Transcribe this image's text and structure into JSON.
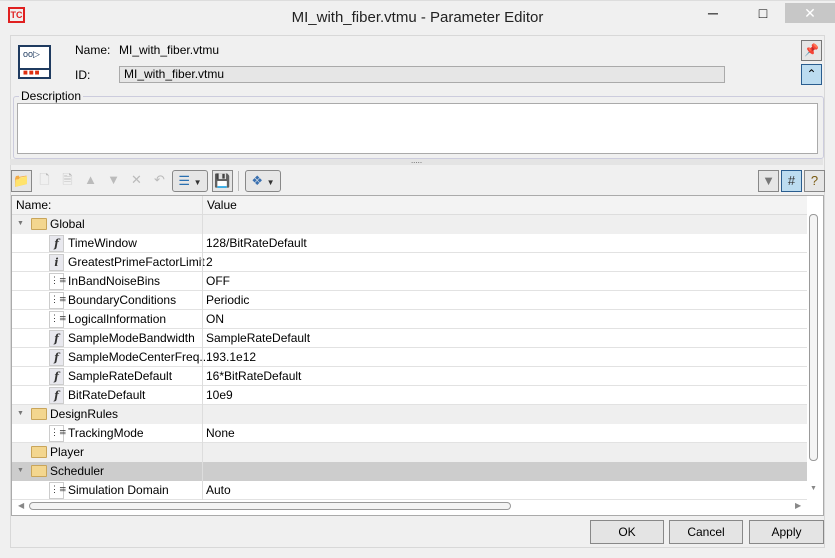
{
  "window": {
    "title": "MI_with_fiber.vtmu - Parameter Editor",
    "logo": "TC",
    "minimize": "minimize-icon",
    "maximize": "maximize-icon",
    "close": "close-icon"
  },
  "header": {
    "name_label": "Name:",
    "name_value": "MI_with_fiber.vtmu",
    "id_label": "ID:",
    "id_value": "MI_with_fiber.vtmu"
  },
  "description": {
    "label": "Description",
    "value": ""
  },
  "table": {
    "columns": [
      "Name:",
      "Value"
    ],
    "rows": [
      {
        "type": "group",
        "name": "Global",
        "value": ""
      },
      {
        "type": "param",
        "icon": "f",
        "name": "TimeWindow",
        "value": "128/BitRateDefault"
      },
      {
        "type": "param",
        "icon": "i",
        "name": "GreatestPrimeFactorLimit",
        "value": "2"
      },
      {
        "type": "param",
        "icon": "list",
        "name": "InBandNoiseBins",
        "value": "OFF"
      },
      {
        "type": "param",
        "icon": "list",
        "name": "BoundaryConditions",
        "value": "Periodic"
      },
      {
        "type": "param",
        "icon": "list",
        "name": "LogicalInformation",
        "value": "ON"
      },
      {
        "type": "param",
        "icon": "f",
        "name": "SampleModeBandwidth",
        "value": "SampleRateDefault"
      },
      {
        "type": "param",
        "icon": "f",
        "name": "SampleModeCenterFreq...",
        "value": "193.1e12"
      },
      {
        "type": "param",
        "icon": "f",
        "name": "SampleRateDefault",
        "value": "16*BitRateDefault"
      },
      {
        "type": "param",
        "icon": "f",
        "name": "BitRateDefault",
        "value": "10e9"
      },
      {
        "type": "group",
        "name": "DesignRules",
        "value": ""
      },
      {
        "type": "param",
        "icon": "list",
        "name": "TrackingMode",
        "value": "None"
      },
      {
        "type": "group",
        "name": "Player",
        "value": "",
        "noarrow": true
      },
      {
        "type": "group",
        "name": "Scheduler",
        "value": "",
        "selected": true
      },
      {
        "type": "param",
        "icon": "list",
        "name": "Simulation Domain",
        "value": "Auto"
      }
    ]
  },
  "buttons": {
    "ok": "OK",
    "cancel": "Cancel",
    "apply": "Apply"
  }
}
